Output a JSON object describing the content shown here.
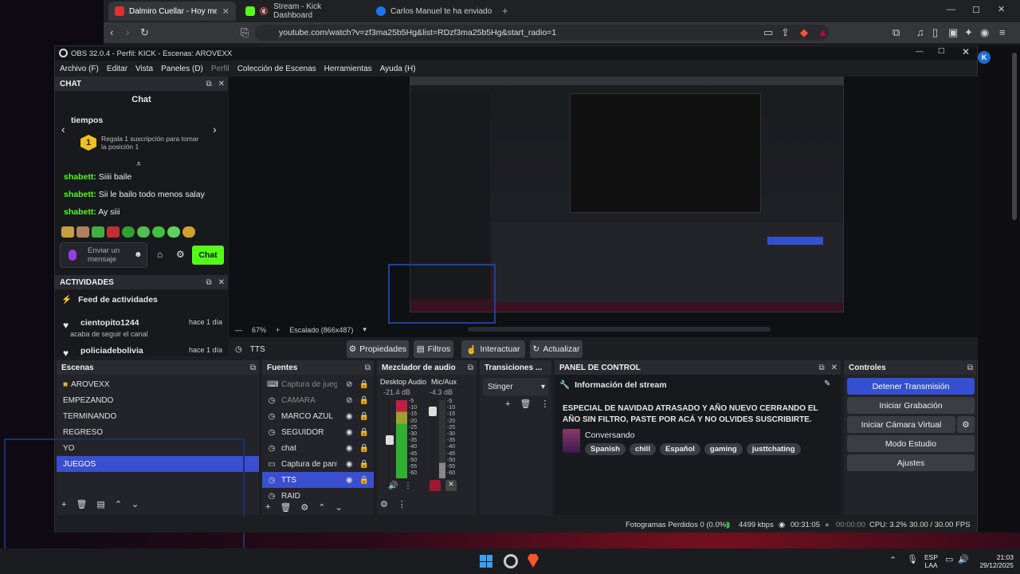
{
  "browser": {
    "tabs": [
      {
        "label": "Dalmiro Cuellar - Hoy me ire",
        "active": true,
        "icon": "youtube-icon",
        "color": "#e03030"
      },
      {
        "label": "Stream - Kick Dashboard",
        "active": false,
        "icon": "kick-icon",
        "color": "#53fc18"
      },
      {
        "label": "Carlos Manuel te ha enviado un men",
        "active": false,
        "icon": "facebook-icon",
        "color": "#1877f2"
      }
    ],
    "url": "youtube.com/watch?v=zf3ma25b5Hg&list=RDzf3ma25b5Hg&start_radio=1"
  },
  "obs": {
    "title": "OBS 32.0.4 - Perfil: KICK - Escenas: AROVEXX",
    "menu": [
      "Archivo (F)",
      "Editar",
      "Vista",
      "Paneles (D)",
      "Perfil",
      "Colección de Escenas",
      "Herramientas",
      "Ayuda (H)"
    ],
    "chat": {
      "header": "CHAT",
      "title": "Chat",
      "pinned_word": "tiempos",
      "gift_rank": "1",
      "gift_text": "Regala 1 suscripción para tomar la posición 1",
      "messages": [
        {
          "user": "shabett:",
          "text": "Siiii baile"
        },
        {
          "user": "shabett:",
          "text": "Sii le bailo todo menos salay"
        },
        {
          "user": "shabett:",
          "text": "Ay siii"
        }
      ],
      "input_placeholder": "Enviar un mensaje",
      "send_label": "Chat"
    },
    "activity": {
      "header": "ACTIVIDADES",
      "title": "Feed de actividades",
      "items": [
        {
          "user": "cientopito1244",
          "action": "acaba de seguir el canal",
          "time": "hace 1 día"
        },
        {
          "user": "policiadebolivia",
          "action": "",
          "time": "hace 1 día"
        }
      ]
    },
    "preview": {
      "zoom": "67%",
      "scale": "Escalado (866x487)"
    },
    "source_toolbar": {
      "selected": "TTS",
      "properties": "Propiedades",
      "filters": "Filtros",
      "interact": "Interactuar",
      "refresh": "Actualizar"
    },
    "scenes": {
      "header": "Escenas",
      "items": [
        {
          "label": "AROVEXX",
          "folder": true,
          "selected": false
        },
        {
          "label": "EMPEZANDO",
          "folder": false,
          "selected": false
        },
        {
          "label": "TERMINANDO",
          "folder": false,
          "selected": false
        },
        {
          "label": "REGRESO",
          "folder": false,
          "selected": false
        },
        {
          "label": "YO",
          "folder": false,
          "selected": false
        },
        {
          "label": "JUEGOS",
          "folder": false,
          "selected": true
        }
      ]
    },
    "sources": {
      "header": "Fuentes",
      "items": [
        {
          "label": "Captura de juego",
          "icon": "gamepad-icon",
          "hidden": true,
          "selected": false
        },
        {
          "label": "CAMARA",
          "icon": "camera-icon",
          "hidden": true,
          "selected": false
        },
        {
          "label": "MARCO AZUL",
          "icon": "globe-icon",
          "hidden": false,
          "selected": false
        },
        {
          "label": "SEGUIDOR",
          "icon": "globe-icon",
          "hidden": false,
          "selected": false
        },
        {
          "label": "chat",
          "icon": "globe-icon",
          "hidden": false,
          "selected": false
        },
        {
          "label": "Captura de panta",
          "icon": "monitor-icon",
          "hidden": false,
          "selected": false
        },
        {
          "label": "TTS",
          "icon": "globe-icon",
          "hidden": false,
          "selected": true
        },
        {
          "label": "RAID",
          "icon": "globe-icon",
          "hidden": false,
          "selected": false
        }
      ]
    },
    "mixer": {
      "header": "Mezclador de audio",
      "channels": [
        {
          "name": "Desktop Audio",
          "db": "-21.4 dB",
          "level": 0.55
        },
        {
          "name": "Mic/Aux",
          "db": "-4.3 dB",
          "level": 0.85
        }
      ],
      "scale": [
        "-5",
        "-10",
        "-15",
        "-20",
        "-25",
        "-30",
        "-35",
        "-40",
        "-45",
        "-50",
        "-55",
        "-60"
      ]
    },
    "transitions": {
      "header": "Transiciones ...",
      "selected": "Stinger"
    },
    "control": {
      "header": "PANEL DE CONTROL",
      "info_title": "Información del stream",
      "stream_title": "ESPECIAL DE NAVIDAD ATRASADO Y AÑO NUEVO CERRANDO EL AÑO SIN FILTRO, PASTE POR ACÁ Y NO OLVIDES SUSCRIBIRTE.",
      "category": "Conversando",
      "tags": [
        "Spanish",
        "chill",
        "Español",
        "gaming",
        "justtchating"
      ]
    },
    "controls": {
      "header": "Controles",
      "stop_stream": "Detener Transmisión",
      "start_recording": "Iniciar Grabación",
      "start_vcam": "Iniciar Cámara Virtual",
      "studio_mode": "Modo Estudio",
      "settings": "Ajustes"
    },
    "status": {
      "dropped": "Fotogramas Perdidos 0 (0.0%)",
      "bitrate": "4499 kbps",
      "stream_time": "00:31:05",
      "rec_time": "00:00:00",
      "cpu": "CPU: 3.2%",
      "fps": "30.00 / 30.00 FPS"
    }
  },
  "taskbar": {
    "lang": "ESP",
    "lang2": "LAA",
    "time": "21:03",
    "date": "29/12/2025"
  },
  "colors": {
    "accent": "#3450d0",
    "kick_green": "#53fc18"
  }
}
